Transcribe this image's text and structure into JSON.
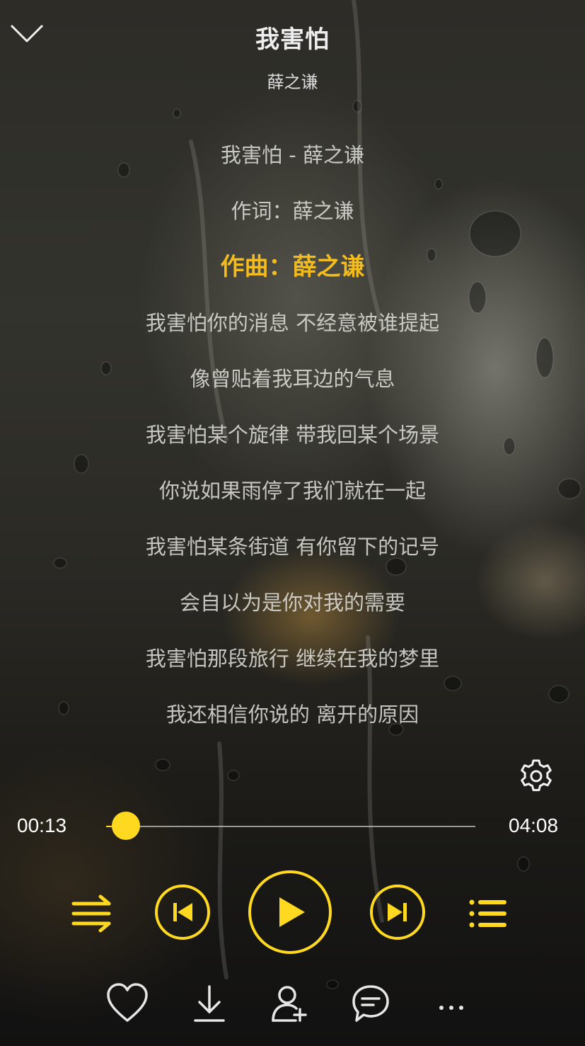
{
  "header": {
    "title": "我害怕",
    "artist": "薛之谦"
  },
  "lyrics": {
    "active_index": 2,
    "lines": [
      "我害怕 - 薛之谦",
      "作词：薛之谦",
      "作曲：薛之谦",
      "我害怕你的消息 不经意被谁提起",
      "像曾贴着我耳边的气息",
      "我害怕某个旋律 带我回某个场景",
      "你说如果雨停了我们就在一起",
      "我害怕某条街道 有你留下的记号",
      "会自以为是你对我的需要",
      "我害怕那段旅行 继续在我的梦里",
      "我还相信你说的 离开的原因"
    ]
  },
  "player": {
    "current_time": "00:13",
    "total_time": "04:08",
    "progress_fraction": 0.053
  },
  "colors": {
    "accent": "#ffd920",
    "active_lyric": "#f2bb1e",
    "lyric": "#dcdcd7",
    "icon": "#e6e6e6"
  },
  "icons": {
    "back": "chevron-down-icon",
    "settings": "gear-icon",
    "mode": "shuffle-icon",
    "prev": "skip-previous-icon",
    "play": "play-icon",
    "next": "skip-next-icon",
    "playlist": "playlist-icon",
    "like": "heart-icon",
    "download": "download-icon",
    "share": "user-add-icon",
    "comment": "comment-icon",
    "more": "more-icon"
  }
}
